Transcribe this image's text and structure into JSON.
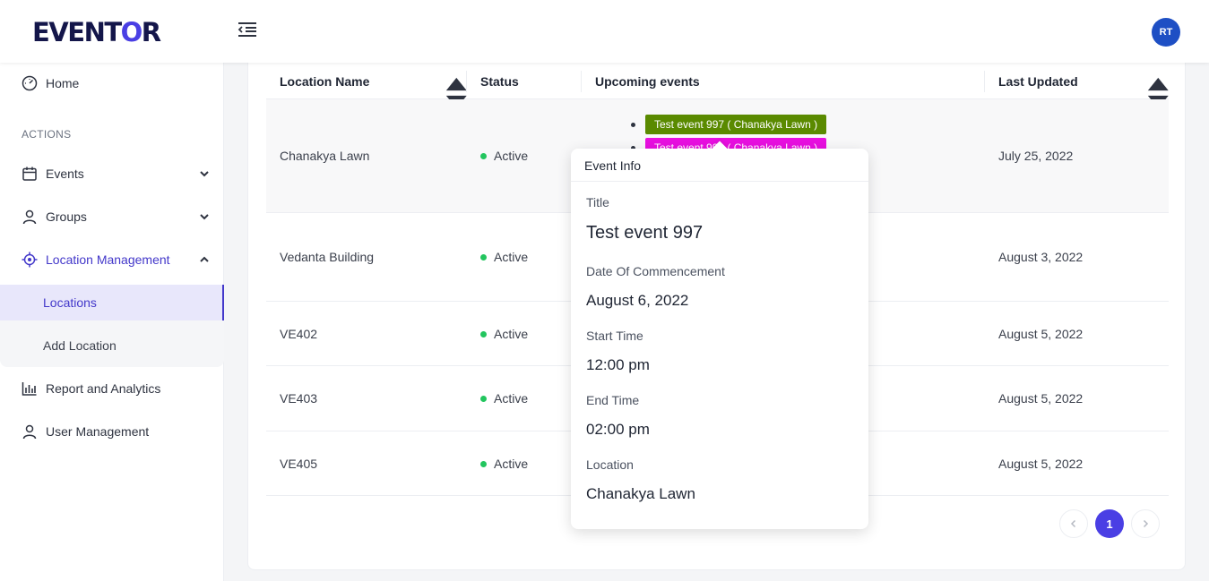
{
  "app": {
    "logo_pre": "EVENT",
    "logo_o": "O",
    "logo_post": "R",
    "user_initials": "RT"
  },
  "sidebar": {
    "home": "Home",
    "section": "ACTIONS",
    "events": "Events",
    "groups": "Groups",
    "location_management": "Location Management",
    "locations": "Locations",
    "add_location": "Add Location",
    "report": "Report and Analytics",
    "user_management": "User Management"
  },
  "table": {
    "headers": {
      "name": "Location Name",
      "status": "Status",
      "upcoming": "Upcoming events",
      "updated": "Last Updated"
    },
    "rows": [
      {
        "name": "Chanakya Lawn",
        "status": "Active",
        "updated": "July 25, 2022",
        "events": [
          "Test event 997 ( Chanakya Lawn )",
          "Test event 999 ( Chanakya Lawn )"
        ]
      },
      {
        "name": "Vedanta Building",
        "status": "Active",
        "updated": "August 3, 2022"
      },
      {
        "name": "VE402",
        "status": "Active",
        "updated": "August 5, 2022"
      },
      {
        "name": "VE403",
        "status": "Active",
        "updated": "August 5, 2022"
      },
      {
        "name": "VE405",
        "status": "Active",
        "updated": "August 5, 2022"
      }
    ]
  },
  "pagination": {
    "current": "1"
  },
  "popover": {
    "header": "Event Info",
    "title_label": "Title",
    "title_value": "Test event 997",
    "date_label": "Date Of Commencement",
    "date_value": "August 6, 2022",
    "start_label": "Start Time",
    "start_value": "12:00 pm",
    "end_label": "End Time",
    "end_value": "02:00 pm",
    "location_label": "Location",
    "location_value": "Chanakya Lawn"
  },
  "colors": {
    "accent": "#4a3fe4",
    "active_dot": "#22c55e",
    "tag_green": "#5a8a00",
    "tag_magenta": "#e80fe0"
  }
}
